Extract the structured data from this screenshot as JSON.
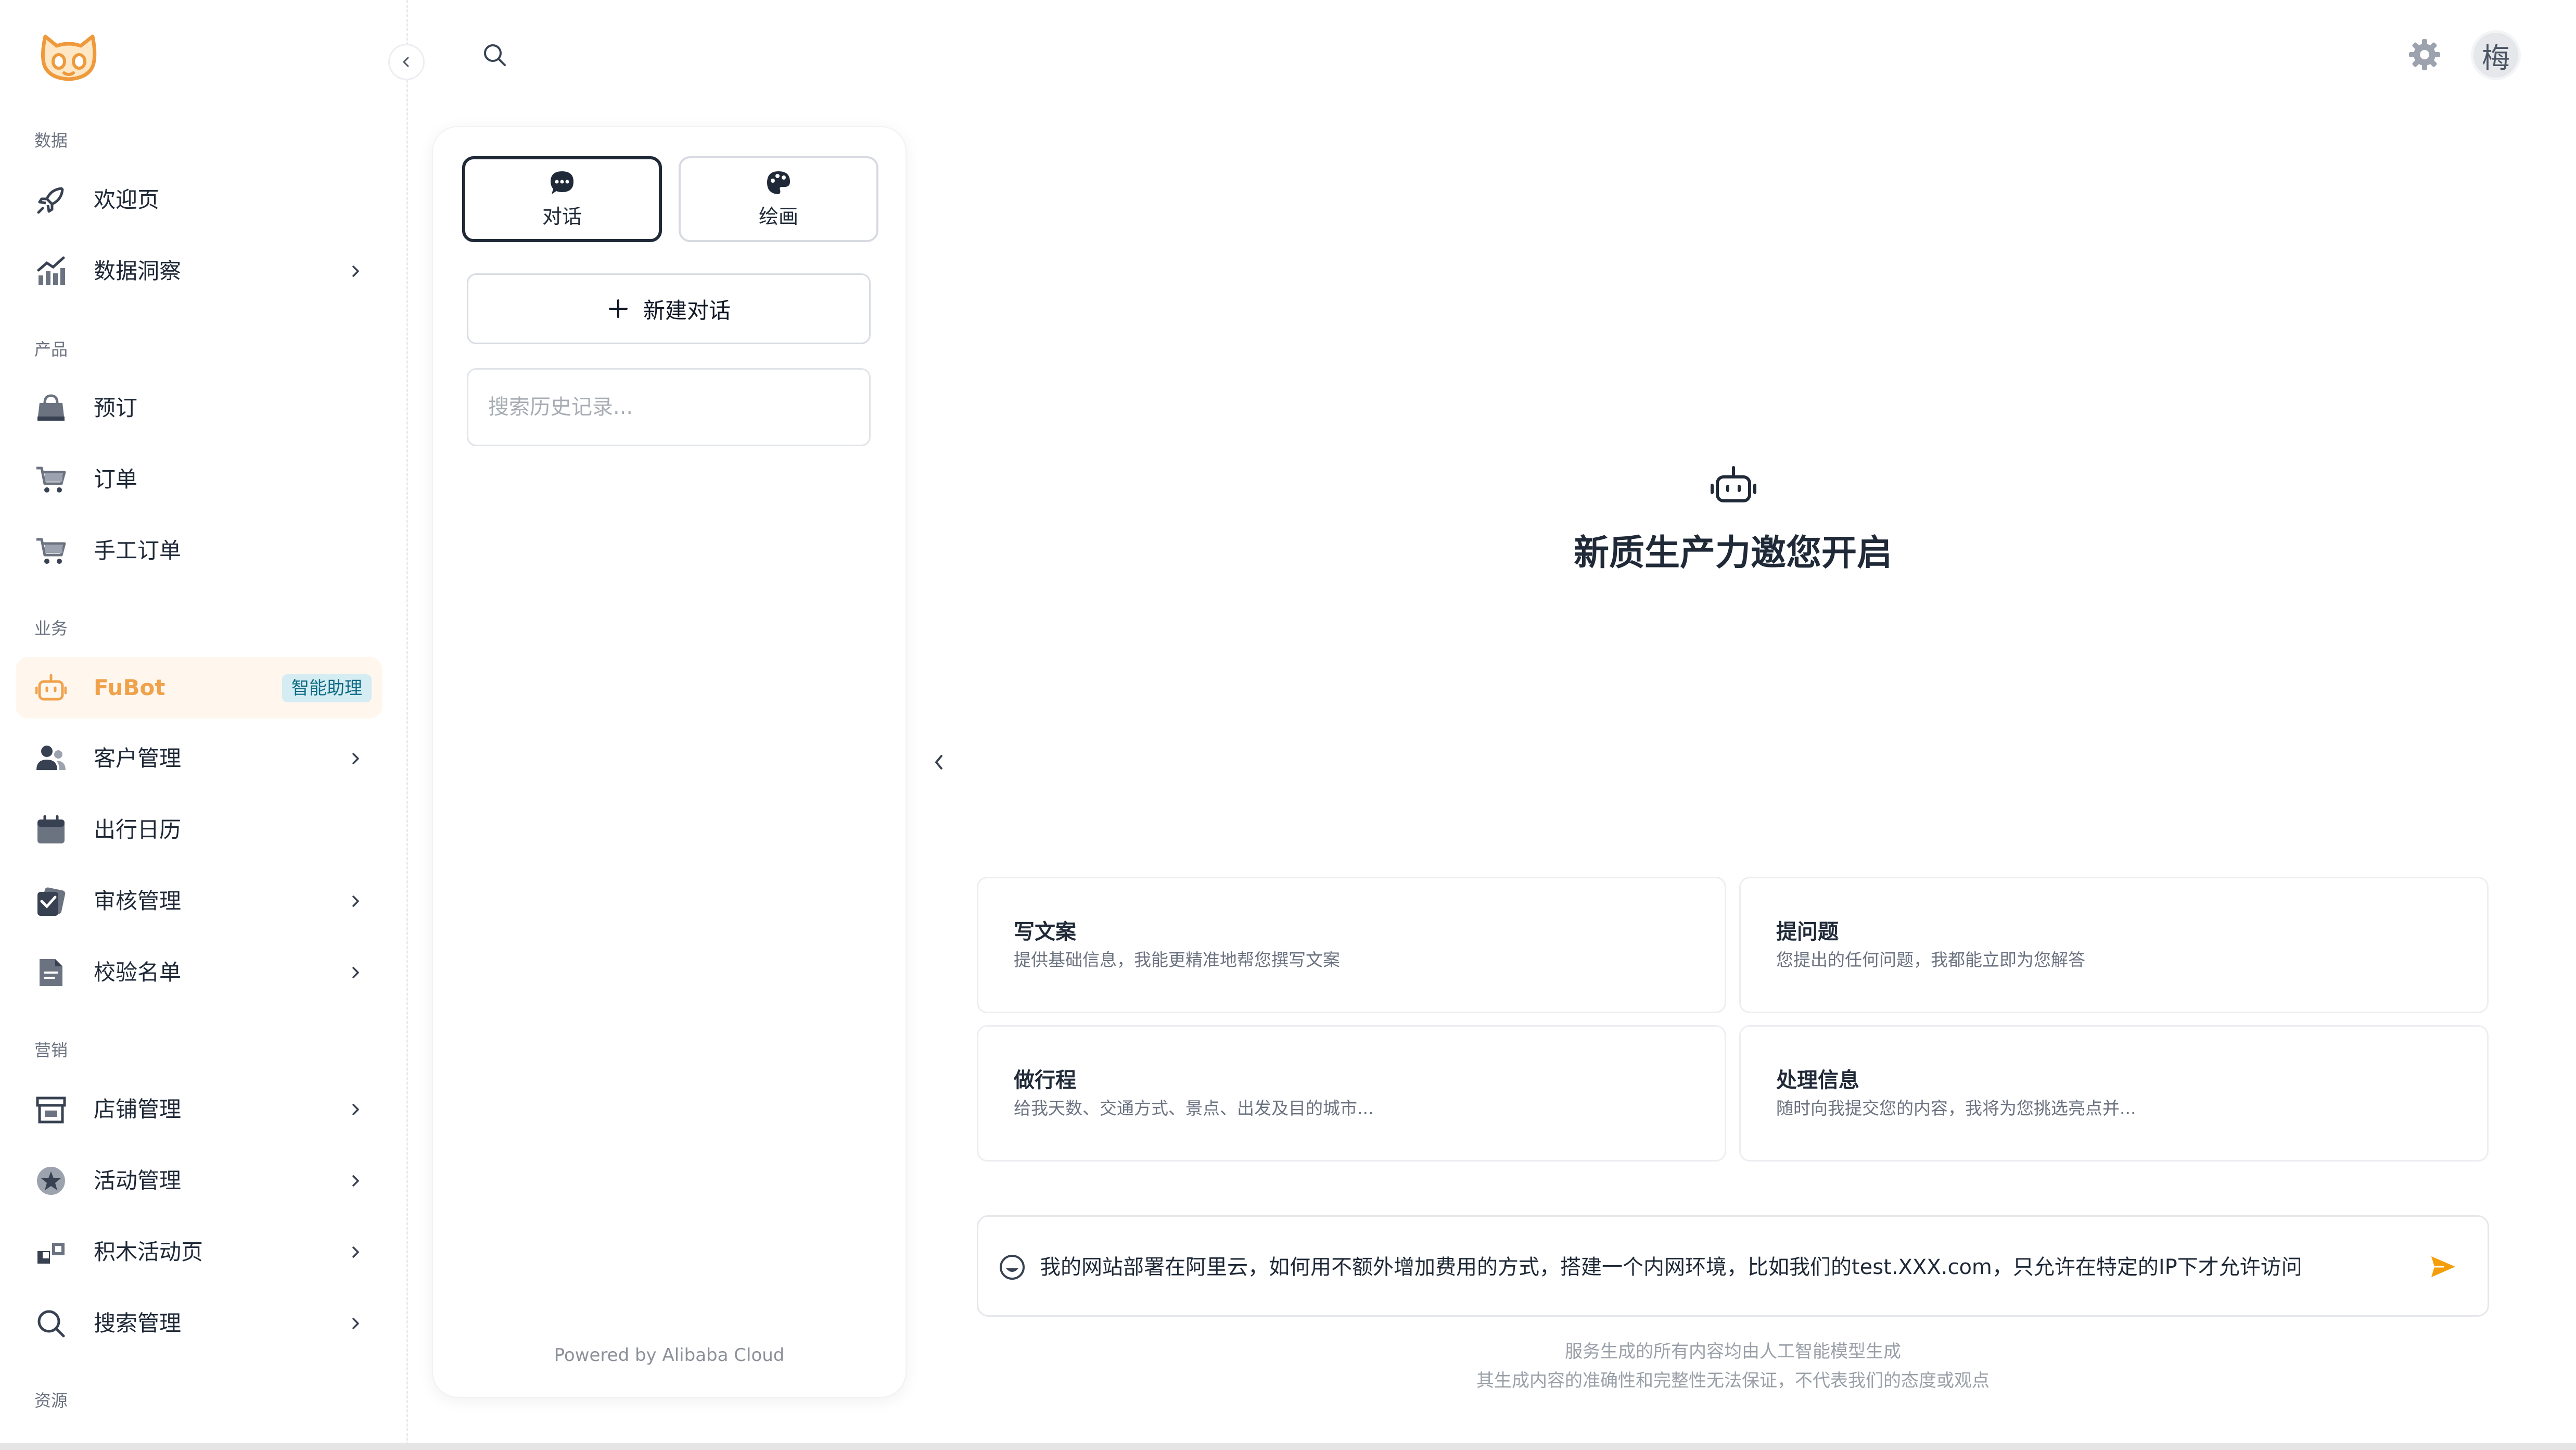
{
  "sidebar": {
    "groups": [
      {
        "title": "数据"
      },
      {
        "title": "产品"
      },
      {
        "title": "业务"
      },
      {
        "title": "营销"
      },
      {
        "title": "资源"
      }
    ],
    "items": [
      {
        "label": "欢迎页",
        "icon": "rocket-icon"
      },
      {
        "label": "数据洞察",
        "icon": "chart-icon",
        "expandable": true
      },
      {
        "label": "预订",
        "icon": "bag-icon"
      },
      {
        "label": "订单",
        "icon": "cart-icon"
      },
      {
        "label": "手工订单",
        "icon": "cart-icon"
      },
      {
        "label": "FuBot",
        "icon": "robot-icon",
        "active": true,
        "badge": "智能助理"
      },
      {
        "label": "客户管理",
        "icon": "users-icon",
        "expandable": true
      },
      {
        "label": "出行日历",
        "icon": "calendar-icon"
      },
      {
        "label": "审核管理",
        "icon": "stamp-icon",
        "expandable": true
      },
      {
        "label": "校验名单",
        "icon": "document-icon",
        "expandable": true
      },
      {
        "label": "店铺管理",
        "icon": "store-icon",
        "expandable": true
      },
      {
        "label": "活动管理",
        "icon": "star-badge-icon",
        "expandable": true
      },
      {
        "label": "积木活动页",
        "icon": "blocks-icon",
        "expandable": true
      },
      {
        "label": "搜索管理",
        "icon": "search-icon",
        "expandable": true
      }
    ]
  },
  "header": {
    "avatar_text": "梅"
  },
  "panel": {
    "modes": [
      {
        "label": "对话",
        "icon": "chat-bubble-icon",
        "selected": true
      },
      {
        "label": "绘画",
        "icon": "palette-icon",
        "selected": false
      }
    ],
    "new_chat_label": "新建对话",
    "search_placeholder": "搜索历史记录...",
    "powered_by": "Powered by Alibaba Cloud"
  },
  "main": {
    "welcome_title": "新质生产力邀您开启",
    "cards": [
      {
        "title": "写文案",
        "desc": "提供基础信息，我能更精准地帮您撰写文案"
      },
      {
        "title": "提问题",
        "desc": "您提出的任何问题，我都能立即为您解答"
      },
      {
        "title": "做行程",
        "desc": "给我天数、交通方式、景点、出发及目的城市..."
      },
      {
        "title": "处理信息",
        "desc": "随时向我提交您的内容，我将为您挑选亮点并..."
      }
    ],
    "input_value": "我的网站部署在阿里云，如何用不额外增加费用的方式，搭建一个内网环境，比如我们的test.XXX.com，只允许在特定的IP下才允许访问",
    "disclaimer_1": "服务生成的所有内容均由人工智能模型生成",
    "disclaimer_2": "其生成内容的准确性和完整性无法保证，不代表我们的态度或观点"
  },
  "colors": {
    "accent": "#f0a24b",
    "active_bg": "#fff6ee",
    "badge_bg": "#d5ecf2",
    "badge_text": "#0f6c85",
    "send": "#f59e0b"
  }
}
